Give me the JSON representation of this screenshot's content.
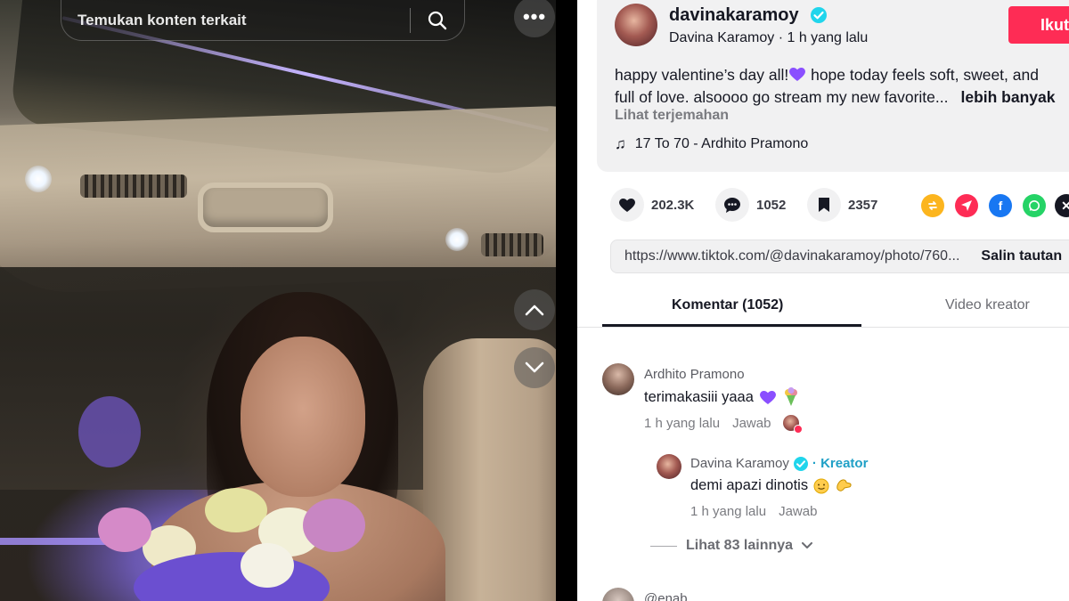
{
  "search": {
    "placeholder": "Temukan konten terkait"
  },
  "post": {
    "handle": "davinakaramoy",
    "display_name": "Davina Karamoy",
    "time_ago": "1 h yang lalu",
    "meta": "Davina Karamoy · 1 h yang lalu",
    "follow_label": "Ikuti",
    "caption_line1_a": "happy valentine’s day all!",
    "caption_line1_b": " hope today feels soft, sweet, and",
    "caption_line2": "full of love. alsoooo go stream my new favorite...",
    "more_label": "lebih banyak",
    "translate_label": "Lihat terjemahan",
    "music": "17 To 70 - Ardhito Pramono",
    "likes": "202.3K",
    "comments": "1052",
    "saves": "2357",
    "link": "https://www.tiktok.com/@davinakaramoy/photo/760...",
    "copy_label": "Salin tautan"
  },
  "share_icons": [
    "repost-icon",
    "send-icon",
    "facebook-icon",
    "whatsapp-icon",
    "x-icon"
  ],
  "colors": {
    "accent": "#fe2c55",
    "verified": "#20d5ec",
    "heart_purple": "#8a4fff"
  },
  "tabs": {
    "comments": "Komentar (1052)",
    "creator_videos": "Video kreator"
  },
  "comments": [
    {
      "author": "Ardhito Pramono",
      "text": "terimakasiii yaaa",
      "time": "1 h yang lalu",
      "reply_label": "Jawab"
    },
    {
      "author": "Davina Karamoy",
      "badge": "Kreator",
      "text": "demi apazi dinotis",
      "time": "1 h yang lalu",
      "reply_label": "Jawab"
    }
  ],
  "view_more": "Lihat 83 lainnya",
  "partial_next_author": "@enab"
}
